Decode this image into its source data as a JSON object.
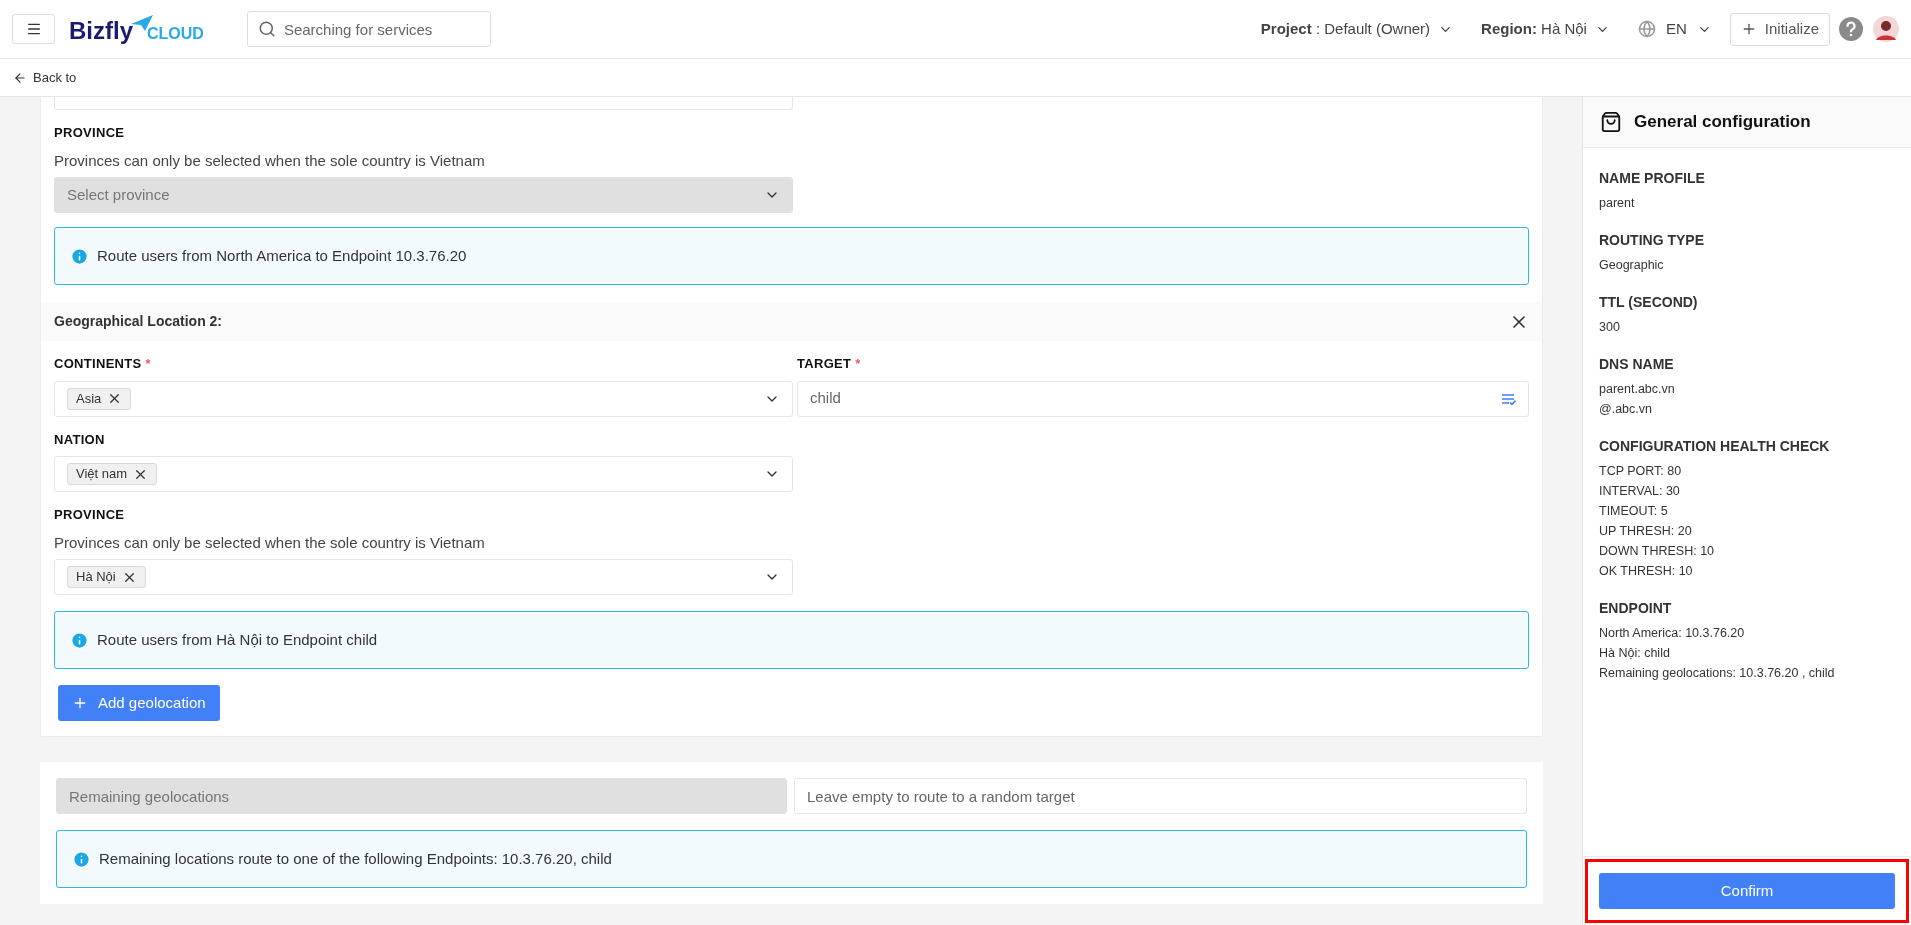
{
  "header": {
    "logo": {
      "brand": "Bizfly",
      "sub": "CLOUD"
    },
    "search": {
      "placeholder": "Searching for services"
    },
    "project": {
      "label": "Project",
      "value": " : Default (Owner)"
    },
    "region": {
      "label": "Region:",
      "value": "Hà Nội"
    },
    "language": "EN",
    "initialize": "Initialize"
  },
  "back": "Back to",
  "location_1": {
    "province": {
      "label": "PROVINCE",
      "hint": "Provinces can only be selected when the sole country is Vietnam",
      "placeholder": "Select province",
      "disabled": true
    },
    "info": "Route users from North America to Endpoint 10.3.76.20"
  },
  "location_2": {
    "title": "Geographical Location 2:",
    "continents": {
      "label": "CONTINENTS",
      "required_mark": "*",
      "tags": [
        "Asia"
      ]
    },
    "target": {
      "label": "TARGET",
      "required_mark": "*",
      "value": "child"
    },
    "nation": {
      "label": "NATION",
      "tags": [
        "Việt nam"
      ]
    },
    "province": {
      "label": "PROVINCE",
      "hint": "Provinces can only be selected when the sole country is Vietnam",
      "tags": [
        "Hà Nội"
      ],
      "disabled": false
    },
    "info": "Route users from Hà Nội to Endpoint child"
  },
  "add_button": "Add geolocation",
  "remaining": {
    "field": {
      "placeholder": "Remaining geolocations",
      "disabled": true
    },
    "target": {
      "placeholder": "Leave empty to route to a random target"
    },
    "info": "Remaining locations route to one of the following Endpoints: 10.3.76.20, child"
  },
  "summary": {
    "title": "General configuration",
    "sections": [
      {
        "heading": "NAME PROFILE",
        "lines": [
          "parent"
        ]
      },
      {
        "heading": "ROUTING TYPE",
        "lines": [
          "Geographic"
        ]
      },
      {
        "heading": "TTL (SECOND)",
        "lines": [
          "300"
        ]
      },
      {
        "heading": "DNS NAME",
        "lines": [
          "parent.abc.vn",
          "@.abc.vn"
        ]
      },
      {
        "heading": "CONFIGURATION HEALTH CHECK",
        "lines": [
          "TCP PORT: 80",
          "INTERVAL: 30",
          "TIMEOUT: 5",
          "UP THRESH: 20",
          "DOWN THRESH: 10",
          "OK THRESH: 10"
        ]
      },
      {
        "heading": "ENDPOINT",
        "lines": [
          "North America: 10.3.76.20",
          "Hà Nội: child",
          "Remaining geolocations: 10.3.76.20 , child"
        ]
      }
    ],
    "confirm": "Confirm",
    "confirm_highlighted": true
  }
}
